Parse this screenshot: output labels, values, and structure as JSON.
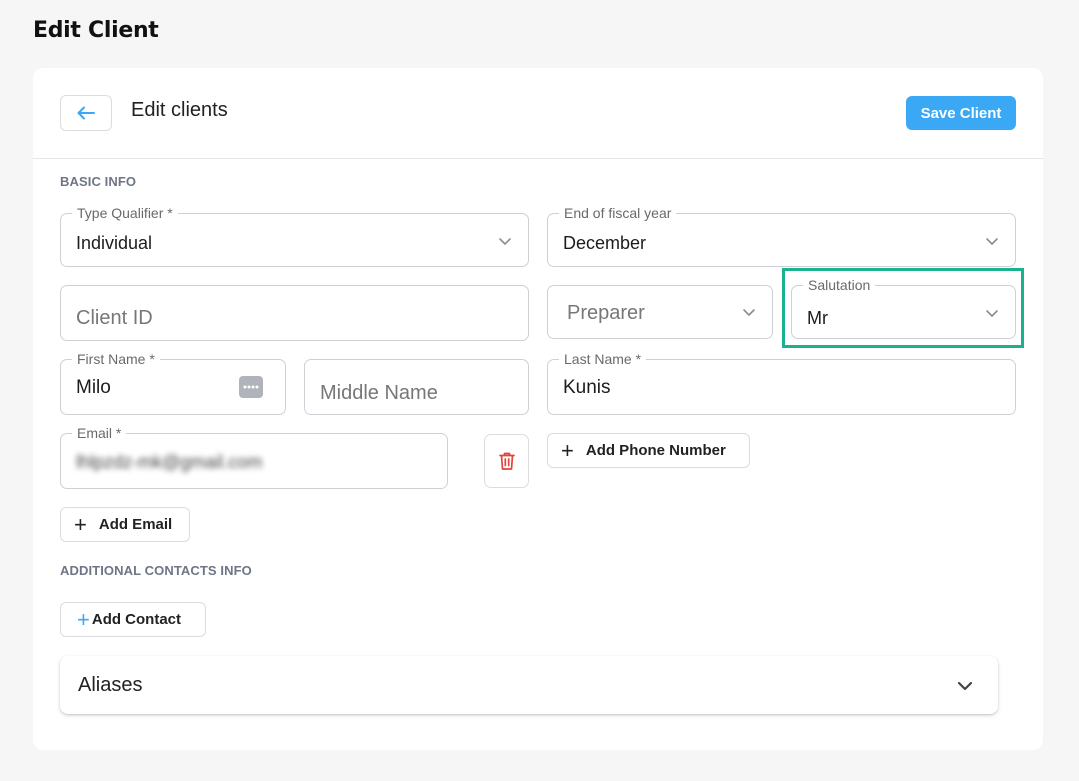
{
  "page": {
    "title": "Edit Client"
  },
  "header": {
    "title": "Edit clients",
    "save_label": "Save Client"
  },
  "basic_info": {
    "section_label": "BASIC INFO",
    "type_qualifier": {
      "label": "Type Qualifier *",
      "value": "Individual"
    },
    "fiscal_year": {
      "label": "End of fiscal year",
      "value": "December"
    },
    "client_id": {
      "placeholder": "Client ID"
    },
    "preparer": {
      "placeholder": "Preparer"
    },
    "salutation": {
      "label": "Salutation",
      "value": "Mr"
    },
    "first_name": {
      "label": "First Name *",
      "value": "Milo"
    },
    "middle_name": {
      "placeholder": "Middle Name"
    },
    "last_name": {
      "label": "Last Name *",
      "value": "Kunis"
    },
    "email": {
      "label": "Email *",
      "value": "lhlpzdz-mk@gmail.com"
    },
    "add_phone_label": "Add Phone Number",
    "add_email_label": "Add Email"
  },
  "additional": {
    "section_label": "ADDITIONAL CONTACTS INFO",
    "add_contact_label": "Add Contact"
  },
  "aliases": {
    "label": "Aliases"
  },
  "colors": {
    "accent": "#3aa8f5",
    "highlight": "#18b28c",
    "danger": "#e0453a"
  },
  "icons": [
    "arrow-left-icon",
    "chevron-down-icon",
    "password-dots-icon",
    "trash-icon",
    "plus-icon"
  ]
}
